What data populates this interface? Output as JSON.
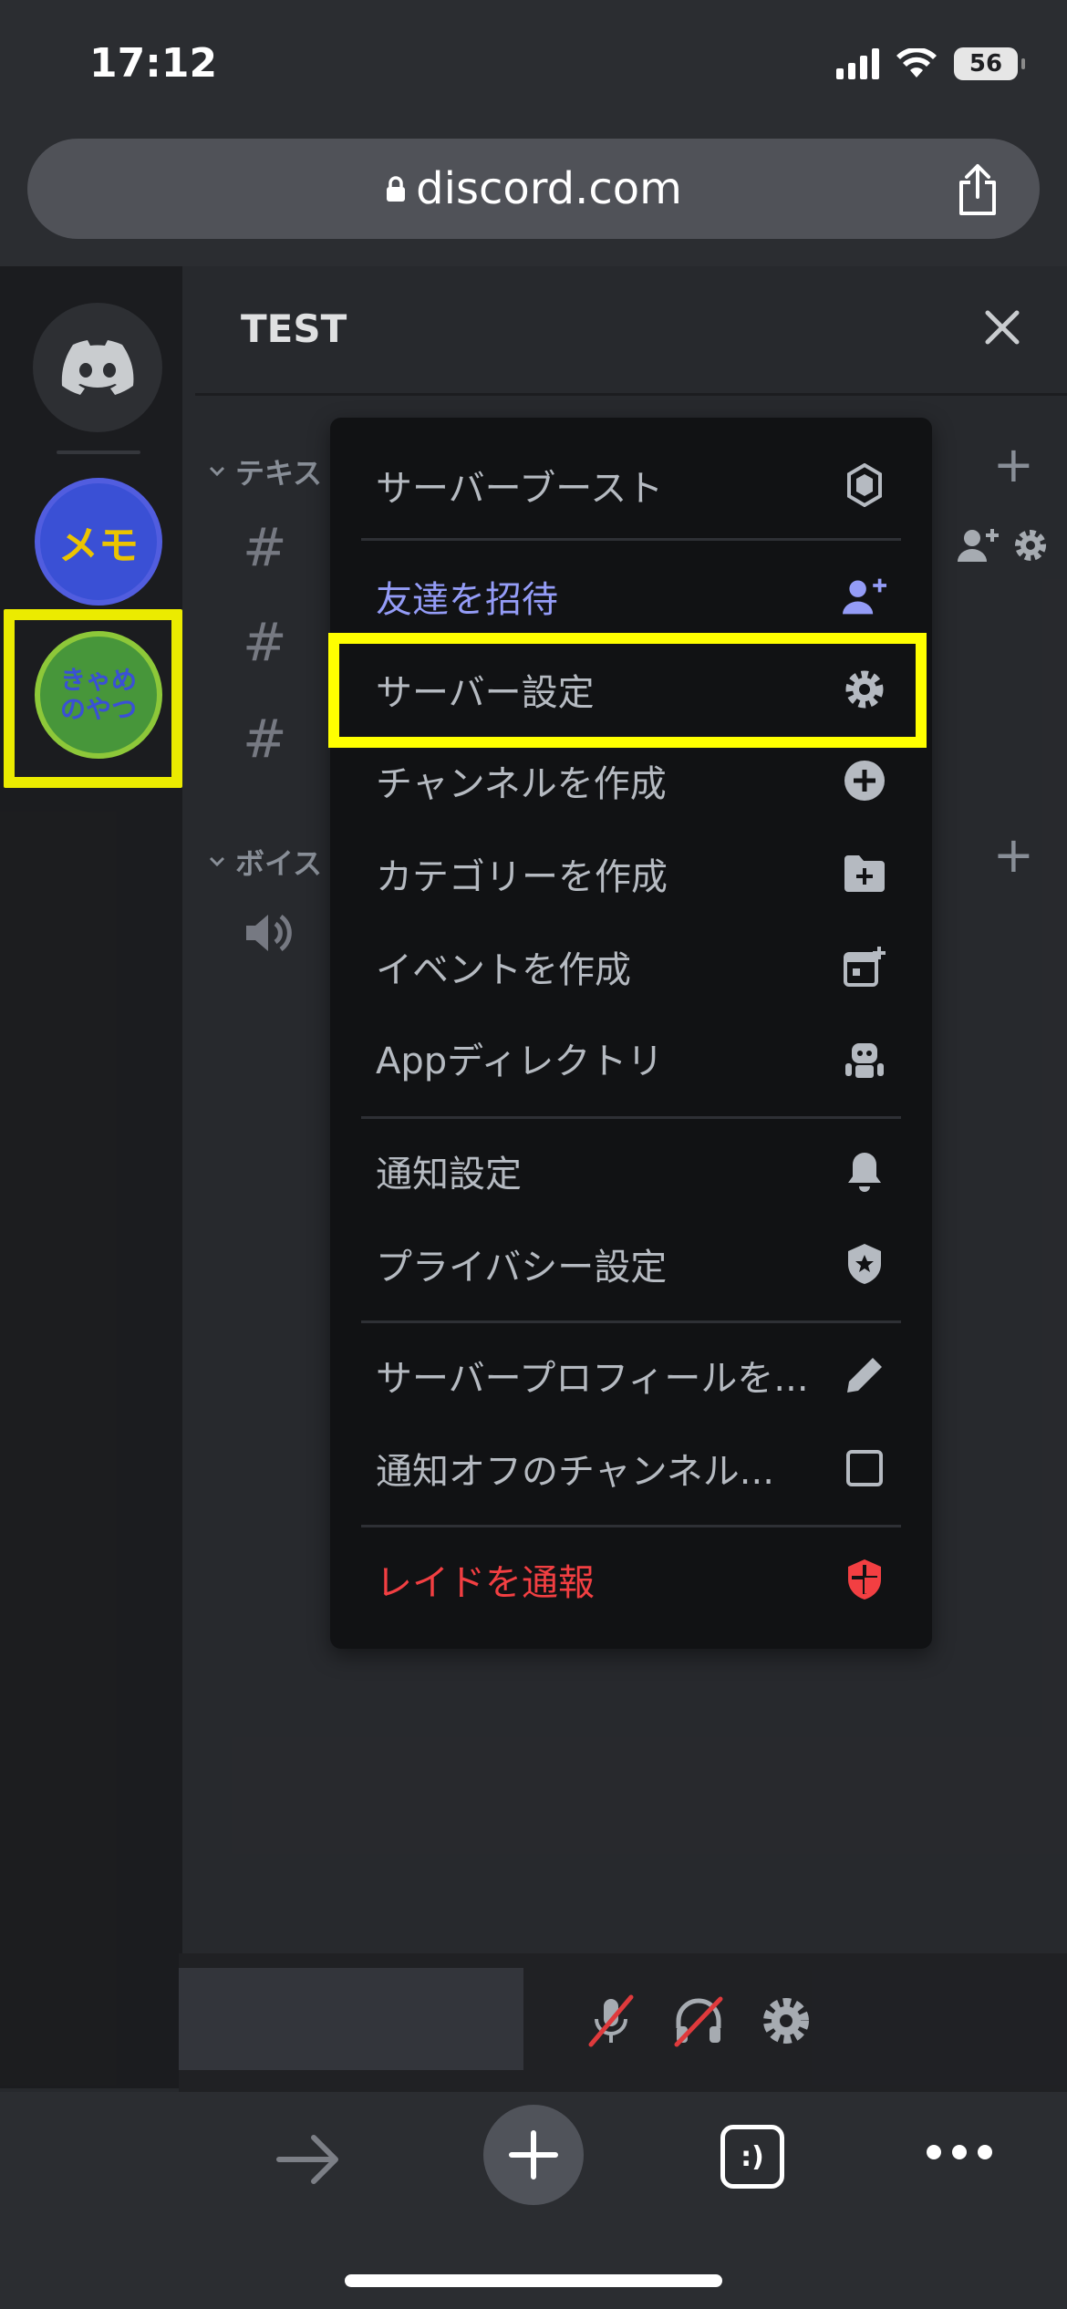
{
  "status": {
    "time": "17:12",
    "battery": "56"
  },
  "browser": {
    "url": "discord.com"
  },
  "rail": {
    "servers": [
      {
        "label": "メモ"
      },
      {
        "label_line1": "きゃめ",
        "label_line2": "のやつ"
      }
    ]
  },
  "panel": {
    "title": "TEST",
    "categories": [
      {
        "label": "テキス"
      },
      {
        "label": "ボイス"
      }
    ],
    "channel_hash": "#"
  },
  "menu": {
    "items": [
      {
        "label": "サーバーブースト",
        "icon": "boost-icon"
      },
      {
        "label": "友達を招待",
        "icon": "add-member-icon"
      },
      {
        "label": "サーバー設定",
        "icon": "gear-icon"
      },
      {
        "label": "チャンネルを作成",
        "icon": "plus-circle-icon"
      },
      {
        "label": "カテゴリーを作成",
        "icon": "folder-plus-icon"
      },
      {
        "label": "イベントを作成",
        "icon": "calendar-plus-icon"
      },
      {
        "label": "Appディレクトリ",
        "icon": "robot-icon"
      },
      {
        "label": "通知設定",
        "icon": "bell-icon"
      },
      {
        "label": "プライバシー設定",
        "icon": "shield-star-icon"
      },
      {
        "label": "サーバープロフィールを...",
        "icon": "pencil-icon"
      },
      {
        "label": "通知オフのチャンネル...",
        "icon": "checkbox-icon"
      },
      {
        "label": "レイドを通報",
        "icon": "shield-danger-icon"
      }
    ]
  },
  "toolbar": {
    "tabs_label": ":)"
  },
  "colors": {
    "highlight": "#ffff00",
    "invite": "#949cf7",
    "danger": "#f23f42",
    "menu_bg": "#111214"
  }
}
